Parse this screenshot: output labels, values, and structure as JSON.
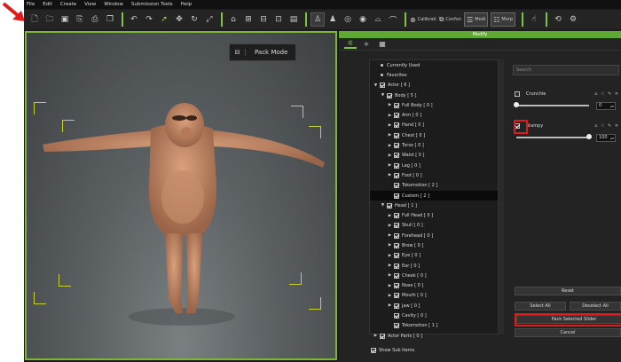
{
  "menu": [
    "File",
    "Edit",
    "Create",
    "View",
    "Window",
    "Submission Tools",
    "Help"
  ],
  "toolbar": {
    "calibration_label": "Calibrati",
    "conform_label": "Confon",
    "modify_label": "Modi",
    "morph_label": "Morp"
  },
  "viewport": {
    "pack_mode_label": "Pack Mode"
  },
  "panel": {
    "title": "Modify",
    "tree": [
      {
        "indent": 0,
        "arrow": "",
        "kind": "dot",
        "label": "Currently Used"
      },
      {
        "indent": 0,
        "arrow": "",
        "kind": "dot",
        "label": "Favorites"
      },
      {
        "indent": 0,
        "arrow": "▼",
        "kind": "cb",
        "label": "Actor [ 6 ]"
      },
      {
        "indent": 1,
        "arrow": "▼",
        "kind": "cb",
        "label": "Body [ 5 ]"
      },
      {
        "indent": 2,
        "arrow": "▶",
        "kind": "cb",
        "label": "Full Body [ 0 ]"
      },
      {
        "indent": 2,
        "arrow": "▶",
        "kind": "cb",
        "label": "Arm [ 0 ]"
      },
      {
        "indent": 2,
        "arrow": "▶",
        "kind": "cb",
        "label": "Hand [ 0 ]"
      },
      {
        "indent": 2,
        "arrow": "▶",
        "kind": "cb",
        "label": "Chest [ 0 ]"
      },
      {
        "indent": 2,
        "arrow": "▶",
        "kind": "cb",
        "label": "Torso [ 0 ]"
      },
      {
        "indent": 2,
        "arrow": "▶",
        "kind": "cb",
        "label": "Waist [ 0 ]"
      },
      {
        "indent": 2,
        "arrow": "▶",
        "kind": "cb",
        "label": "Leg [ 0 ]"
      },
      {
        "indent": 2,
        "arrow": "▶",
        "kind": "cb",
        "label": "Foot [ 0 ]"
      },
      {
        "indent": 2,
        "arrow": "",
        "kind": "cb",
        "label": "Tokomotion [ 2 ]"
      },
      {
        "indent": 2,
        "arrow": "",
        "kind": "cb",
        "label": "Custom [ 2 ]",
        "highlight": true
      },
      {
        "indent": 1,
        "arrow": "▼",
        "kind": "cb",
        "label": "Head [ 1 ]"
      },
      {
        "indent": 2,
        "arrow": "▶",
        "kind": "cb",
        "label": "Full Head [ 0 ]"
      },
      {
        "indent": 2,
        "arrow": "▶",
        "kind": "cb",
        "label": "Skull [ 0 ]"
      },
      {
        "indent": 2,
        "arrow": "▶",
        "kind": "cb",
        "label": "Forehead [ 0 ]"
      },
      {
        "indent": 2,
        "arrow": "▶",
        "kind": "cb",
        "label": "Brow [ 0 ]"
      },
      {
        "indent": 2,
        "arrow": "▶",
        "kind": "cb",
        "label": "Eye [ 0 ]"
      },
      {
        "indent": 2,
        "arrow": "▶",
        "kind": "cb",
        "label": "Ear [ 0 ]"
      },
      {
        "indent": 2,
        "arrow": "▶",
        "kind": "cb",
        "label": "Cheek [ 0 ]"
      },
      {
        "indent": 2,
        "arrow": "▶",
        "kind": "cb",
        "label": "Nose [ 0 ]"
      },
      {
        "indent": 2,
        "arrow": "▶",
        "kind": "cb",
        "label": "Mouth [ 0 ]"
      },
      {
        "indent": 2,
        "arrow": "▶",
        "kind": "cb",
        "label": "Jaw [ 0 ]"
      },
      {
        "indent": 2,
        "arrow": "",
        "kind": "cb",
        "label": "Cavity [ 0 ]"
      },
      {
        "indent": 2,
        "arrow": "",
        "kind": "cb",
        "label": "Tokomotion [ 1 ]"
      },
      {
        "indent": 0,
        "arrow": "▶",
        "kind": "cb",
        "label": "Actor Parts [ 0 ]"
      }
    ],
    "show_sub_items": "Show Sub Items",
    "search_placeholder": "Search",
    "sliders": [
      {
        "name": "Crunchie",
        "checked": false,
        "value": "0",
        "fraction": 0
      },
      {
        "name": "Stampy",
        "checked": true,
        "value": "100",
        "fraction": 1
      }
    ],
    "reset_label": "Reset",
    "select_all_label": "Select All",
    "deselect_all_label": "Deselect All",
    "pack_selected_label": "Pack Selected Slider",
    "cancel_label": "Cancel"
  },
  "colors": {
    "accent": "#7ec440",
    "highlight": "#e01b1b",
    "annotation_arrow": "#e01b1b"
  }
}
